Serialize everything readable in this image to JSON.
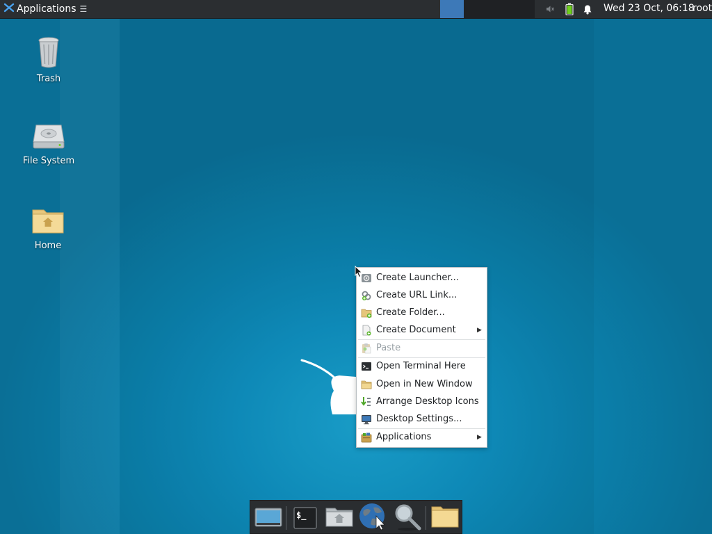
{
  "panel": {
    "apps_label": "Applications",
    "apps_glyph": "☰",
    "clock": "Wed 23 Oct, 06:18",
    "user": "root",
    "tray_icons": [
      "speaker-muted-icon",
      "battery-icon",
      "bell-icon"
    ]
  },
  "desktop": {
    "icons": [
      {
        "label": "Trash",
        "icon": "trash-icon"
      },
      {
        "label": "File System",
        "icon": "drive-icon"
      },
      {
        "label": "Home",
        "icon": "home-folder-icon"
      }
    ]
  },
  "context_menu": {
    "items": [
      {
        "label": "Create Launcher...",
        "icon": "gear-icon"
      },
      {
        "label": "Create URL Link...",
        "icon": "link-icon"
      },
      {
        "label": "Create Folder...",
        "icon": "new-folder-icon"
      },
      {
        "label": "Create Document",
        "icon": "new-document-icon",
        "submenu_arrow": "▶"
      },
      {
        "label": "Paste",
        "icon": "paste-icon",
        "disabled": true
      },
      {
        "label": "Open Terminal Here",
        "icon": "terminal-icon"
      },
      {
        "label": "Open in New Window",
        "icon": "folder-icon"
      },
      {
        "label": "Arrange Desktop Icons",
        "icon": "arrange-icon"
      },
      {
        "label": "Desktop Settings...",
        "icon": "monitor-icon"
      },
      {
        "label": "Applications",
        "icon": "applications-icon",
        "submenu_arrow": "▶"
      }
    ]
  },
  "dock": {
    "items": [
      {
        "icon": "show-desktop-icon"
      },
      {
        "icon": "terminal-icon",
        "text": "$_"
      },
      {
        "icon": "file-manager-icon"
      },
      {
        "icon": "web-browser-icon"
      },
      {
        "icon": "search-icon"
      },
      {
        "icon": "folder-icon"
      }
    ]
  },
  "colors": {
    "panel_bg": "#2b2e31",
    "active_workspace": "#3d79b8",
    "desktop_bg": "#0b7faa",
    "menu_bg": "#ffffff",
    "disabled_text": "#98a0a5"
  }
}
